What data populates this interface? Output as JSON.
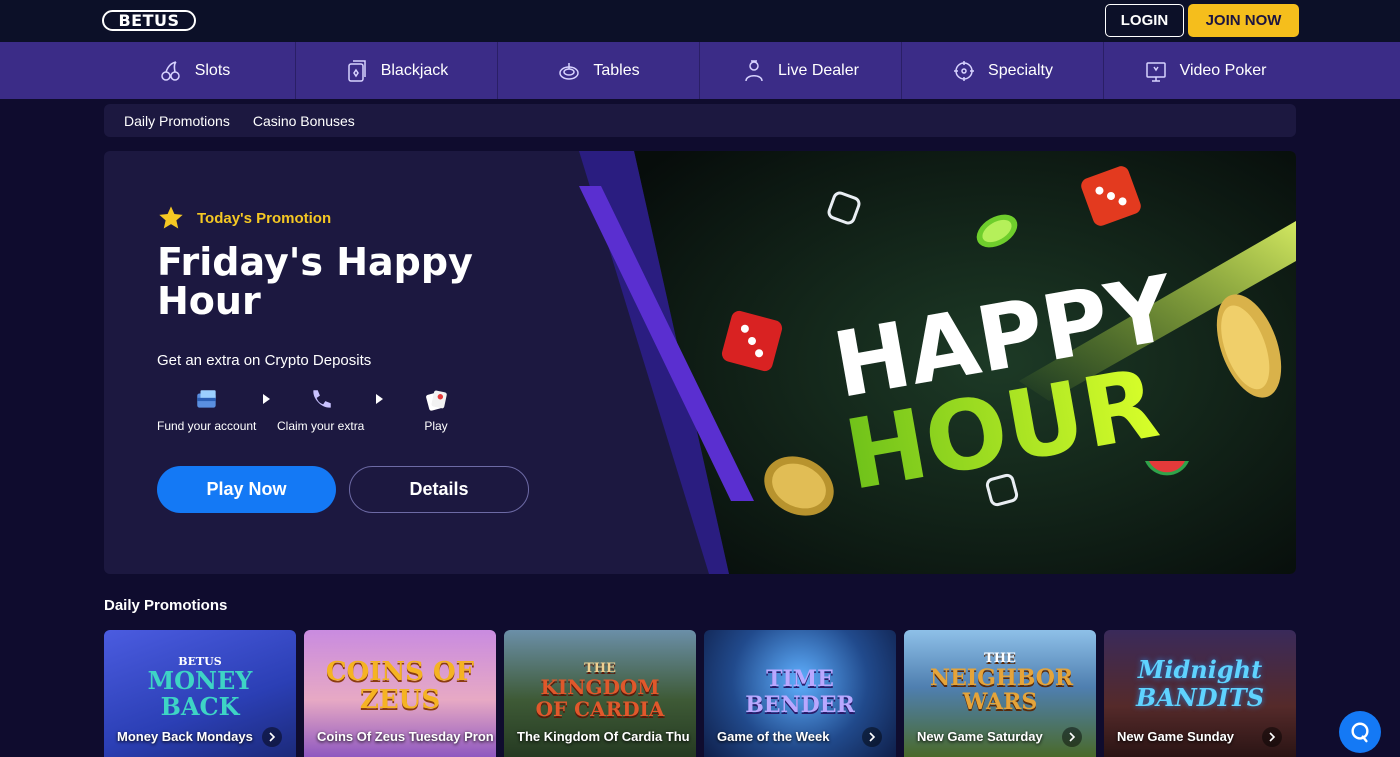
{
  "header": {
    "logo_text": "BETUS",
    "login_label": "LOGIN",
    "join_label": "JOIN NOW"
  },
  "categories": [
    {
      "label": "Slots",
      "icon": "cherries-icon"
    },
    {
      "label": "Blackjack",
      "icon": "cards-icon"
    },
    {
      "label": "Tables",
      "icon": "roulette-icon"
    },
    {
      "label": "Live Dealer",
      "icon": "dealer-icon"
    },
    {
      "label": "Specialty",
      "icon": "wheel-icon"
    },
    {
      "label": "Video Poker",
      "icon": "poker-icon"
    }
  ],
  "subnav": [
    "Daily Promotions",
    "Casino Bonuses"
  ],
  "hero": {
    "tag": "Today's Promotion",
    "title": "Friday's Happy Hour",
    "subtitle": "Get an extra on Crypto Deposits",
    "art_text_1": "HAPPY",
    "art_text_2": "HOUR",
    "steps": [
      "Fund your account",
      "Claim your extra",
      "Play"
    ],
    "play_label": "Play Now",
    "details_label": "Details"
  },
  "daily": {
    "title": "Daily Promotions",
    "cards": [
      {
        "label": "Money Back Mondays",
        "logo_top": "BETUS",
        "logo": "MONEY BACK",
        "bg": "#2b3fb5",
        "accent": "#3ed4c5"
      },
      {
        "label": "Coins Of Zeus Tuesday Pron",
        "logo_top": "",
        "logo": "COINS OF ZEUS",
        "bg": "#c77bd6",
        "accent": "#f5b323"
      },
      {
        "label": "The Kingdom Of Cardia Thu",
        "logo_top": "THE",
        "logo": "KINGDOM OF CARDIA",
        "bg": "#3e5a36",
        "accent": "#e0582b"
      },
      {
        "label": "Game of the Week",
        "logo_top": "",
        "logo": "TIME BENDER",
        "bg": "#214a8c",
        "accent": "#8a7ae0"
      },
      {
        "label": "New Game Saturday",
        "logo_top": "THE",
        "logo": "NEIGHBOR WARS",
        "bg": "#4f7fb0",
        "accent": "#e5a43a"
      },
      {
        "label": "New Game Sunday",
        "logo_top": "",
        "logo": "Midnight BANDITS",
        "bg": "#552a2a",
        "accent": "#5fd3ff"
      }
    ]
  },
  "colors": {
    "accent_blue": "#1479f5",
    "join_yellow": "#f5be1c",
    "nav_purple": "#3b2c87",
    "promo_yellow": "#f5c823"
  }
}
